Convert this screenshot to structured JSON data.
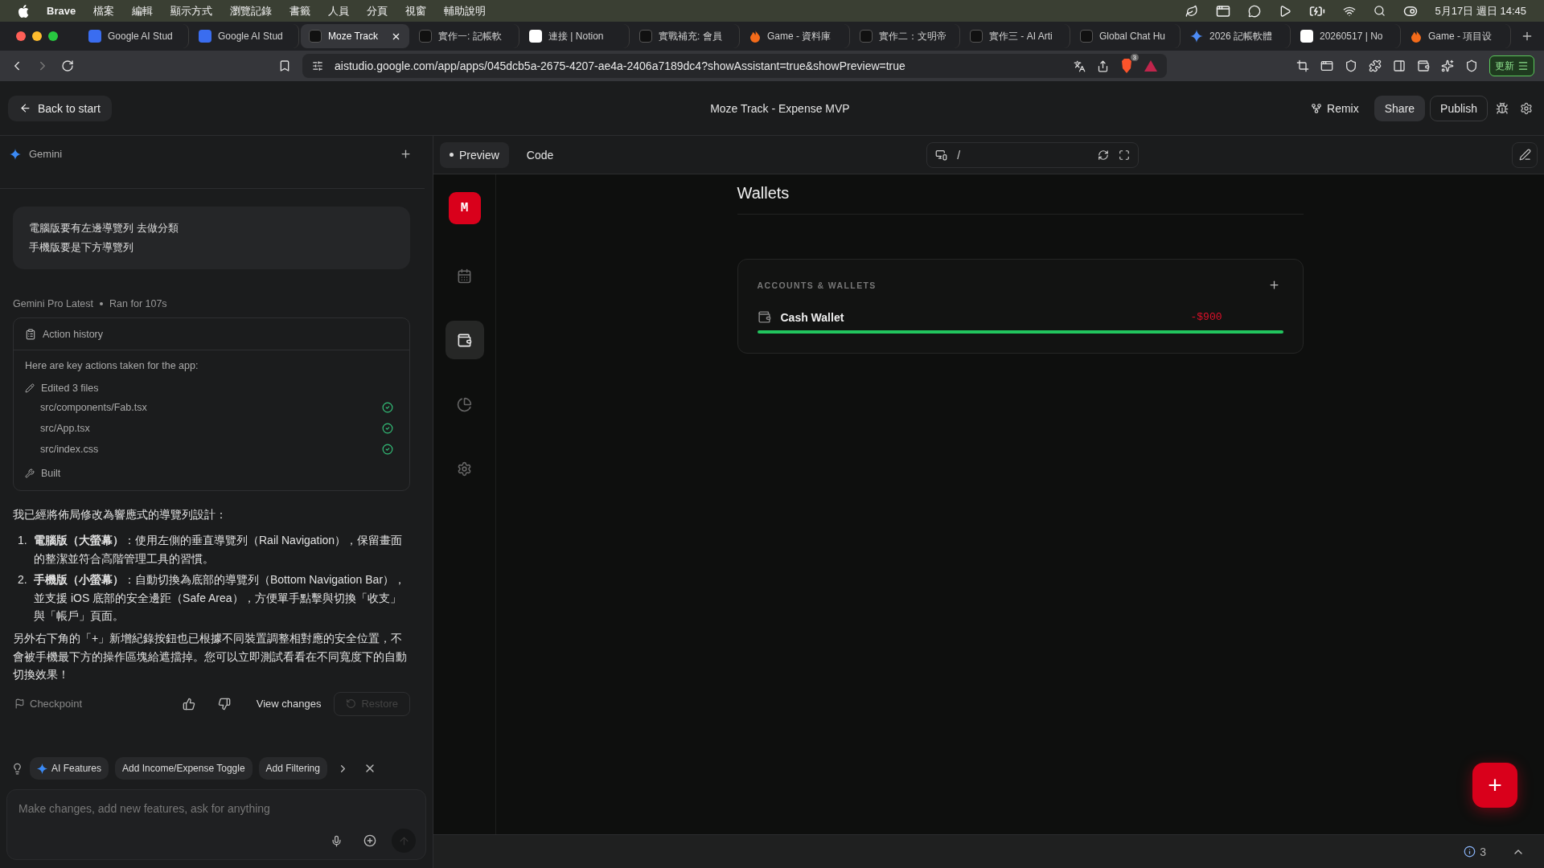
{
  "menubar": {
    "app": "Brave",
    "menus": [
      "檔案",
      "編輯",
      "顯示方式",
      "瀏覽記錄",
      "書籤",
      "人員",
      "分頁",
      "視窗",
      "輔助說明"
    ],
    "clock": "5月17日 週日 14:45"
  },
  "browser_tabs": [
    {
      "title": "Google AI Stud",
      "kind": "aistudio",
      "selected": false
    },
    {
      "title": "Google AI Stud",
      "kind": "aistudio",
      "selected": false
    },
    {
      "title": "Moze Track",
      "kind": "app",
      "selected": true
    },
    {
      "title": "實作一: 記帳軟",
      "kind": "app",
      "selected": false
    },
    {
      "title": "連接 | Notion",
      "kind": "notion",
      "selected": false
    },
    {
      "title": "實戰補充: 會員",
      "kind": "app",
      "selected": false
    },
    {
      "title": "Game - 資料庫",
      "kind": "fire",
      "selected": false
    },
    {
      "title": "實作二：文明帝",
      "kind": "app",
      "selected": false
    },
    {
      "title": "實作三 - AI Arti",
      "kind": "app",
      "selected": false
    },
    {
      "title": "Global Chat Hu",
      "kind": "app",
      "selected": false
    },
    {
      "title": "2026 記帳軟體",
      "kind": "gemini",
      "selected": false
    },
    {
      "title": "20260517 | No",
      "kind": "notion",
      "selected": false
    },
    {
      "title": "Game - 項目设",
      "kind": "fire",
      "selected": false
    }
  ],
  "address_bar": {
    "url": "aistudio.google.com/app/apps/045dcb5a-2675-4207-ae4a-2406a7189dc4?showAssistant=true&showPreview=true",
    "shields_count": "3",
    "update_label": "更新"
  },
  "app_header": {
    "back_label": "Back to start",
    "title": "Moze Track - Expense MVP",
    "remix_label": "Remix",
    "share_label": "Share",
    "publish_label": "Publish"
  },
  "assistant": {
    "title": "Gemini",
    "user_message": [
      "電腦版要有左邊導覽列 去做分類",
      "手機版要是下方導覽列"
    ],
    "model": "Gemini Pro Latest",
    "runtime": "Ran for 107s",
    "action_history": {
      "title": "Action history",
      "intro": "Here are key actions taken for the app:",
      "edited": "Edited 3 files",
      "files": [
        {
          "path": "src/components/Fab.tsx",
          "done": true
        },
        {
          "path": "src/App.tsx",
          "done": true
        },
        {
          "path": "src/index.css",
          "done": true
        }
      ],
      "built": "Built"
    },
    "response_intro": "我已經將佈局修改為響應式的導覽列設計：",
    "response_points": [
      {
        "marker": "1.",
        "text": "**電腦版（大螢幕）**：使用左側的垂直導覽列（Rail Navigation），保留畫面的整潔並符合高階管理工具的習慣。"
      },
      {
        "marker": "2.",
        "text": "**手機版（小螢幕）**：自動切換為底部的導覽列（Bottom Navigation Bar），並支援 iOS 底部的安全邊距（Safe Area），方便單手點擊與切換「收支」與「帳戶」頁面。"
      }
    ],
    "response_outro": "另外右下角的「+」新增紀錄按鈕也已根據不同裝置調整相對應的安全位置，不會被手機最下方的操作區塊給遮擋掉。您可以立即測試看看在不同寬度下的自動切換效果！",
    "checkpoint_label": "Checkpoint",
    "view_changes_label": "View changes",
    "restore": {
      "label": "Restore",
      "disabled": true
    },
    "suggestions": [
      {
        "label": "AI Features",
        "kind": "ai"
      },
      {
        "label": "Add Income/Expense Toggle",
        "kind": "plain"
      },
      {
        "label": "Add Filtering",
        "kind": "plain"
      }
    ],
    "input": {
      "placeholder": "Make changes, add new features, ask for anything"
    }
  },
  "preview": {
    "tabs": [
      {
        "label": "Preview",
        "selected": true
      },
      {
        "label": "Code",
        "selected": false
      }
    ],
    "path": "/",
    "rail": {
      "logo": "M",
      "items": [
        {
          "kind": "calendar",
          "selected": false
        },
        {
          "kind": "wallet",
          "selected": true
        },
        {
          "kind": "chart",
          "selected": false
        },
        {
          "kind": "settings",
          "selected": false
        }
      ]
    },
    "page_title": "Wallets",
    "card_title": "ACCOUNTS & WALLETS",
    "wallets": [
      {
        "name": "Cash Wallet",
        "amount": "-$900",
        "level": 1
      }
    ],
    "fab": "+"
  },
  "status_bar": {
    "issues": "3"
  }
}
